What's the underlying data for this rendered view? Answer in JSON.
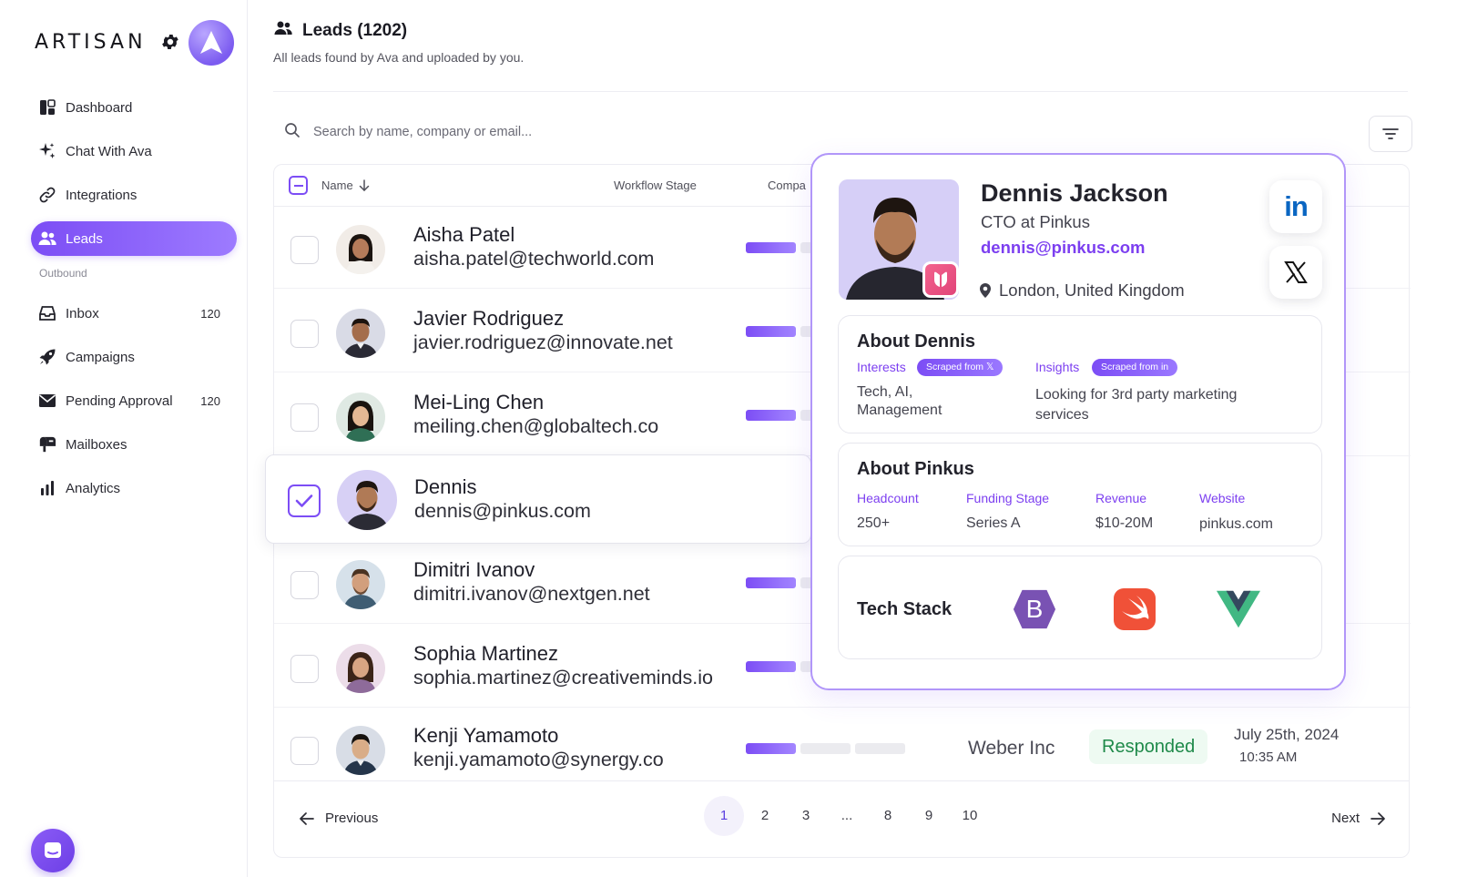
{
  "brand": {
    "logo_text": "ARTISAN"
  },
  "sidebar": {
    "items": [
      {
        "label": "Dashboard",
        "icon": "dashboard-icon"
      },
      {
        "label": "Chat With Ava",
        "icon": "sparkle-icon"
      },
      {
        "label": "Integrations",
        "icon": "link-icon"
      },
      {
        "label": "Leads",
        "icon": "users-icon",
        "active": true
      }
    ],
    "section_label": "Outbound",
    "outbound": [
      {
        "label": "Inbox",
        "count": "120",
        "icon": "inbox-icon"
      },
      {
        "label": "Campaigns",
        "icon": "rocket-icon"
      },
      {
        "label": "Pending Approval",
        "count": "120",
        "icon": "envelope-icon"
      },
      {
        "label": "Mailboxes",
        "icon": "mailbox-icon"
      },
      {
        "label": "Analytics",
        "icon": "bar-chart-icon"
      }
    ]
  },
  "header": {
    "title": "Leads (1202)",
    "subtitle": "All leads found by Ava and uploaded by you."
  },
  "search": {
    "placeholder": "Search by name, company or email..."
  },
  "table": {
    "columns": {
      "name": "Name",
      "workflow": "Workflow Stage",
      "company": "Compa"
    },
    "rows": [
      {
        "name": "Aisha Patel",
        "email": "aisha.patel@techworld.com",
        "stage": 1
      },
      {
        "name": "Javier Rodriguez",
        "email": "javier.rodriguez@innovate.net",
        "stage": 1
      },
      {
        "name": "Mei-Ling Chen",
        "email": "meiling.chen@globaltech.co",
        "stage": 1
      },
      {
        "name": "Dennis",
        "email": "dennis@pinkus.com",
        "selected": true
      },
      {
        "name": "Dimitri Ivanov",
        "email": "dimitri.ivanov@nextgen.net",
        "stage": 1
      },
      {
        "name": "Sophia Martinez",
        "email": "sophia.martinez@creativeminds.io",
        "stage": 1
      },
      {
        "name": "Kenji Yamamoto",
        "email": "kenji.yamamoto@synergy.co",
        "stage": 1,
        "company": "Weber Inc",
        "status": "Responded",
        "date": "July 25th, 2024",
        "time": "10:35 AM"
      }
    ]
  },
  "pagination": {
    "previous": "Previous",
    "next": "Next",
    "pages": [
      "1",
      "2",
      "3",
      "...",
      "8",
      "9",
      "10"
    ],
    "current": "1"
  },
  "profile": {
    "name": "Dennis Jackson",
    "role": "CTO at Pinkus",
    "email": "dennis@pinkus.com",
    "location": "London, United Kingdom",
    "about_title": "About Dennis",
    "interests_label": "Interests",
    "interests_tag": "Scraped from 𝕏",
    "interests_value": "Tech, AI, Management",
    "insights_label": "Insights",
    "insights_tag": "Scraped from in",
    "insights_value": "Looking for 3rd party marketing services",
    "company_title": "About Pinkus",
    "company": {
      "headcount_label": "Headcount",
      "headcount": "250+",
      "funding_label": "Funding Stage",
      "funding": "Series A",
      "revenue_label": "Revenue",
      "revenue": "$10-20M",
      "website_label": "Website",
      "website": "pinkus.com"
    },
    "tech_title": "Tech Stack",
    "tech": [
      {
        "letter": "B",
        "icon": "bootstrap-icon",
        "color": "#7952b3"
      },
      {
        "icon": "swift-icon",
        "color": "#f05138"
      },
      {
        "letter": "V",
        "icon": "vue-icon",
        "color": "#41b883"
      }
    ],
    "linkedin_text": "in"
  },
  "colors": {
    "accent": "#7c4df5",
    "status_green": "#1f8a4a"
  }
}
